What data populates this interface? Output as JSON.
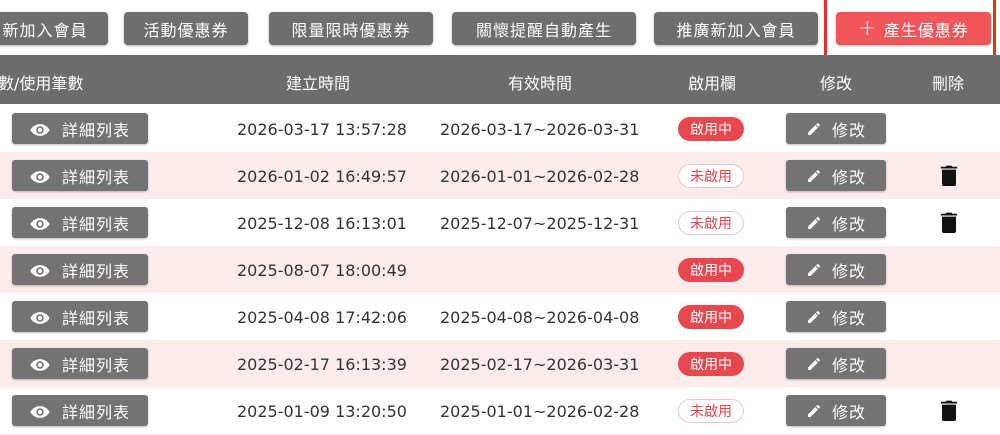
{
  "toolbar": {
    "buttons": [
      {
        "label": "新加入會員"
      },
      {
        "label": "活動優惠券"
      },
      {
        "label": "限量限時優惠券"
      },
      {
        "label": "關懷提醒自動產生"
      },
      {
        "label": "推廣新加入會員"
      }
    ],
    "create": {
      "label": "產生優惠券",
      "icon": "plus-icon"
    }
  },
  "table": {
    "headers": {
      "count": "數/使用筆數",
      "created": "建立時間",
      "valid": "有效時間",
      "enabled": "啟用欄",
      "edit": "修改",
      "delete": "刪除"
    },
    "detail_label": "詳細列表",
    "edit_label": "修改",
    "rows": [
      {
        "created": "2026-03-17 13:57:28",
        "valid": "2026-03-17~2026-03-31",
        "status": "啟用中",
        "deletable": false
      },
      {
        "created": "2026-01-02 16:49:57",
        "valid": "2026-01-01~2026-02-28",
        "status": "未啟用",
        "deletable": true
      },
      {
        "created": "2025-12-08 16:13:01",
        "valid": "2025-12-07~2025-12-31",
        "status": "未啟用",
        "deletable": true
      },
      {
        "created": "2025-08-07 18:00:49",
        "valid": "",
        "status": "啟用中",
        "deletable": false
      },
      {
        "created": "2025-04-08 17:42:06",
        "valid": "2025-04-08~2026-04-08",
        "status": "啟用中",
        "deletable": false
      },
      {
        "created": "2025-02-17 16:13:39",
        "valid": "2025-02-17~2026-03-31",
        "status": "啟用中",
        "deletable": false
      },
      {
        "created": "2025-01-09 13:20:50",
        "valid": "2025-01-01~2026-02-28",
        "status": "未啟用",
        "deletable": true
      }
    ]
  },
  "colors": {
    "accent": "#f0555a",
    "header_bg": "#6c6c6c",
    "button_gray": "#737373",
    "row_alt": "#fdecec",
    "highlight_border": "#dd3322"
  }
}
